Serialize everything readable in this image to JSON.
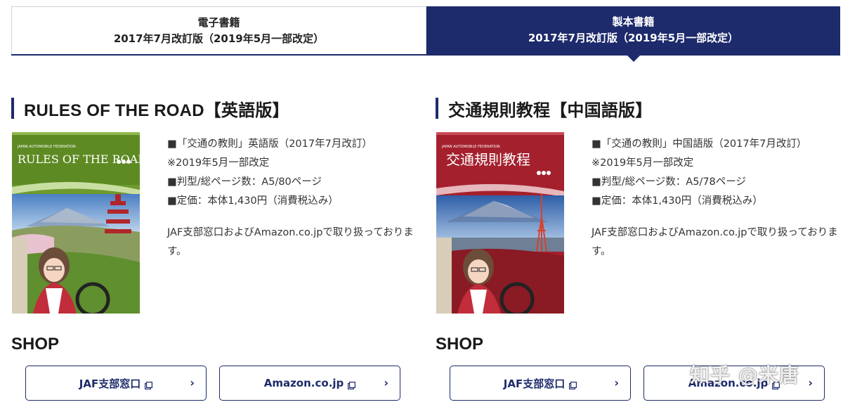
{
  "tabs": [
    {
      "line1": "電子書籍",
      "line2": "2017年7月改訂版（2019年5月一部改定）"
    },
    {
      "line1": "製本書籍",
      "line2": "2017年7月改訂版（2019年5月一部改定）"
    }
  ],
  "products": [
    {
      "title": "RULES OF THE ROAD【英語版】",
      "cover_title": "RULES OF THE ROAD",
      "cover_publisher": "JAPAN AUTOMOBILE FEDERATION",
      "cover_color": "#6e9a2e",
      "details": [
        "■「交通の教則」英語版（2017年7月改訂）",
        "※2019年5月一部改定",
        "■判型/総ページ数：A5/80ページ",
        "■定価：本体1,430円（消費税込み）"
      ],
      "note": "JAF支部窓口およびAmazon.co.jpで取り扱っております。",
      "shop_title": "SHOP",
      "buttons": [
        "JAF支部窓口",
        "Amazon.co.jp"
      ]
    },
    {
      "title": "交通規則教程【中国語版】",
      "cover_title": "交通規則教程",
      "cover_publisher": "JAPAN AUTOMOBILE FEDERATION",
      "cover_color": "#a4202d",
      "details": [
        "■「交通の教則」中国語版（2017年7月改訂）",
        "※2019年5月一部改定",
        "■判型/総ページ数：A5/78ページ",
        "■定価：本体1,430円（消費税込み）"
      ],
      "note": "JAF支部窓口およびAmazon.co.jpで取り扱っております。",
      "shop_title": "SHOP",
      "buttons": [
        "JAF支部窓口",
        "Amazon.co.jp"
      ]
    }
  ],
  "watermark": "知乎 @米唐",
  "icons": {
    "external": "external-link-icon",
    "chevron": "chevron-right-icon"
  },
  "colors": {
    "brand": "#1d2a6b"
  }
}
